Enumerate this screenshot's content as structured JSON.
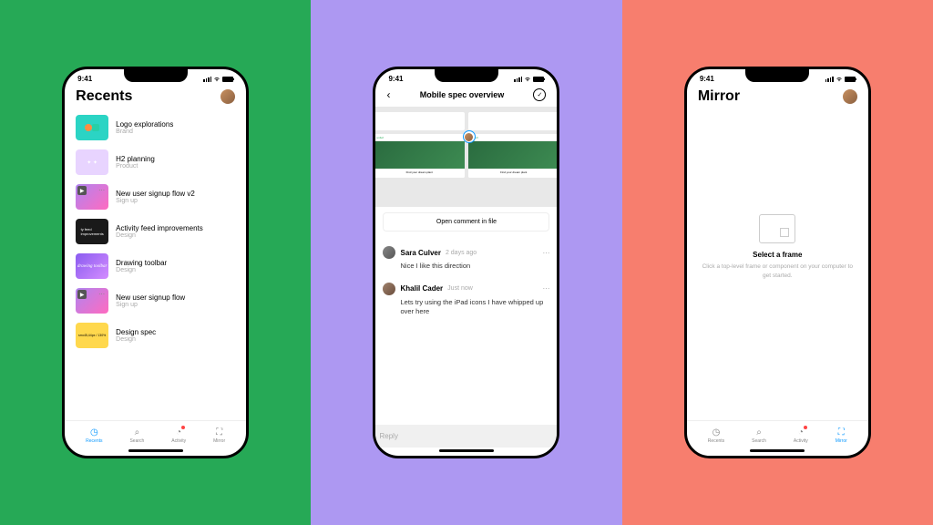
{
  "status_bar": {
    "time": "9:41"
  },
  "recents": {
    "title": "Recents",
    "files": [
      {
        "title": "Logo explorations",
        "sub": "Brand"
      },
      {
        "title": "H2 planning",
        "sub": "Product"
      },
      {
        "title": "New user signup flow v2",
        "sub": "Sign up"
      },
      {
        "title": "Activity feed improvements",
        "sub": "Design"
      },
      {
        "title": "Drawing toolbar",
        "sub": "Design"
      },
      {
        "title": "New user signup flow",
        "sub": "Sign up"
      },
      {
        "title": "Design spec",
        "sub": "Design"
      }
    ]
  },
  "spec": {
    "title": "Mobile spec overview",
    "open_btn": "Open comment in file",
    "mock_caption": "Find your dream plant",
    "comments": [
      {
        "name": "Sara Culver",
        "time": "2 days ago",
        "body": "Nice I like this direction"
      },
      {
        "name": "Khalil Cader",
        "time": "Just now",
        "body": "Lets try using the iPad icons I have whipped up over here"
      }
    ],
    "reply_placeholder": "Reply"
  },
  "mirror": {
    "title": "Mirror",
    "empty_title": "Select a frame",
    "empty_sub": "Click a top-level frame or component on your computer to get started."
  },
  "nav": {
    "recents": "Recents",
    "search": "Search",
    "activity": "Activity",
    "mirror": "Mirror"
  }
}
